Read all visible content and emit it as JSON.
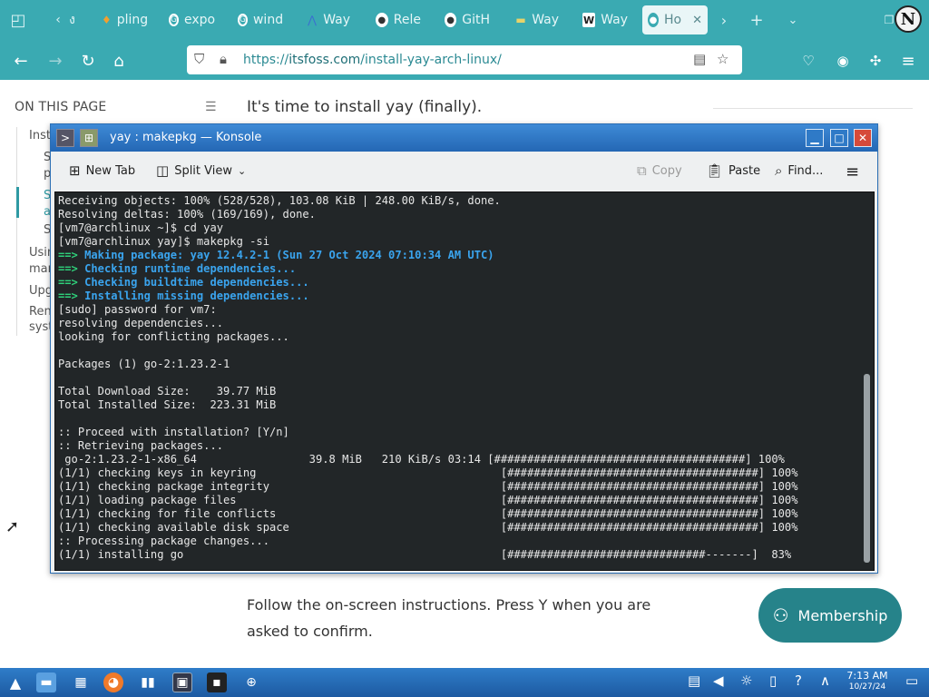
{
  "browser": {
    "tabs": [
      {
        "label": "ง",
        "icon": "tab-icon-1"
      },
      {
        "label": "pling",
        "icon": "pling-icon"
      },
      {
        "label": "expo",
        "icon": "google-icon"
      },
      {
        "label": "wind",
        "icon": "google-icon"
      },
      {
        "label": "Way",
        "icon": "wayland-icon"
      },
      {
        "label": "Rele",
        "icon": "github-icon"
      },
      {
        "label": "GitH",
        "icon": "github-icon"
      },
      {
        "label": "Way",
        "icon": "wayland-icon"
      },
      {
        "label": "Way",
        "icon": "wikipedia-icon"
      },
      {
        "label": "Ho",
        "icon": "itsfoss-icon"
      }
    ],
    "tab_close": "✕",
    "new_tab": "+",
    "avatar_letter": "N",
    "url": {
      "scheme": "https://",
      "host": "itsfoss.com",
      "path": "/install-yay-arch-linux/"
    }
  },
  "page": {
    "toc_title": "ON THIS PAGE",
    "toc_items": [
      "Inst",
      "S",
      "p",
      "S",
      "a",
      "S",
      "Usin",
      "mar",
      "Upg",
      "Ren",
      "syst"
    ],
    "paragraph1": "It's time to install yay (finally).",
    "paragraph2": "Follow the on-screen instructions. Press Y when you are asked to confirm.",
    "membership_label": "Membership"
  },
  "konsole": {
    "title": "yay : makepkg — Konsole",
    "toolbar": {
      "new_tab": "New Tab",
      "split_view": "Split View",
      "copy": "Copy",
      "paste": "Paste",
      "find": "Find..."
    },
    "lines": [
      {
        "text": "Receiving objects: 100% (528/528), 103.08 KiB | 248.00 KiB/s, done.",
        "style": ""
      },
      {
        "text": "Resolving deltas: 100% (169/169), done.",
        "style": ""
      },
      {
        "text": "[vm7@archlinux ~]$ cd yay",
        "style": ""
      },
      {
        "text": "[vm7@archlinux yay]$ makepkg -si",
        "style": ""
      },
      {
        "prefix": "==> ",
        "text": "Making package: yay 12.4.2-1 (Sun 27 Oct 2024 07:10:34 AM UTC)",
        "style": "t-blue"
      },
      {
        "prefix": "==> ",
        "text": "Checking runtime dependencies...",
        "style": "t-blue"
      },
      {
        "prefix": "==> ",
        "text": "Checking buildtime dependencies...",
        "style": "t-blue"
      },
      {
        "prefix": "==> ",
        "text": "Installing missing dependencies...",
        "style": "t-blue"
      },
      {
        "text": "[sudo] password for vm7:",
        "style": ""
      },
      {
        "text": "resolving dependencies...",
        "style": ""
      },
      {
        "text": "looking for conflicting packages...",
        "style": ""
      },
      {
        "text": "",
        "style": ""
      },
      {
        "text": "Packages (1) go-2:1.23.2-1",
        "style": ""
      },
      {
        "text": "",
        "style": ""
      },
      {
        "text": "Total Download Size:    39.77 MiB",
        "style": ""
      },
      {
        "text": "Total Installed Size:  223.31 MiB",
        "style": ""
      },
      {
        "text": "",
        "style": ""
      },
      {
        "text": ":: Proceed with installation? [Y/n]",
        "style": ""
      },
      {
        "text": ":: Retrieving packages...",
        "style": ""
      },
      {
        "text": " go-2:1.23.2-1-x86_64                 39.8 MiB   210 KiB/s 03:14 [######################################] 100%",
        "style": ""
      },
      {
        "text": "(1/1) checking keys in keyring                                     [######################################] 100%",
        "style": ""
      },
      {
        "text": "(1/1) checking package integrity                                   [######################################] 100%",
        "style": ""
      },
      {
        "text": "(1/1) loading package files                                        [######################################] 100%",
        "style": ""
      },
      {
        "text": "(1/1) checking for file conflicts                                  [######################################] 100%",
        "style": ""
      },
      {
        "text": "(1/1) checking available disk space                                [######################################] 100%",
        "style": ""
      },
      {
        "text": ":: Processing package changes...",
        "style": ""
      },
      {
        "text": "(1/1) installing go                                                [##############################-------]  83%",
        "style": ""
      }
    ]
  },
  "taskbar": {
    "time": "7:13 AM",
    "date": "10/27/24"
  }
}
